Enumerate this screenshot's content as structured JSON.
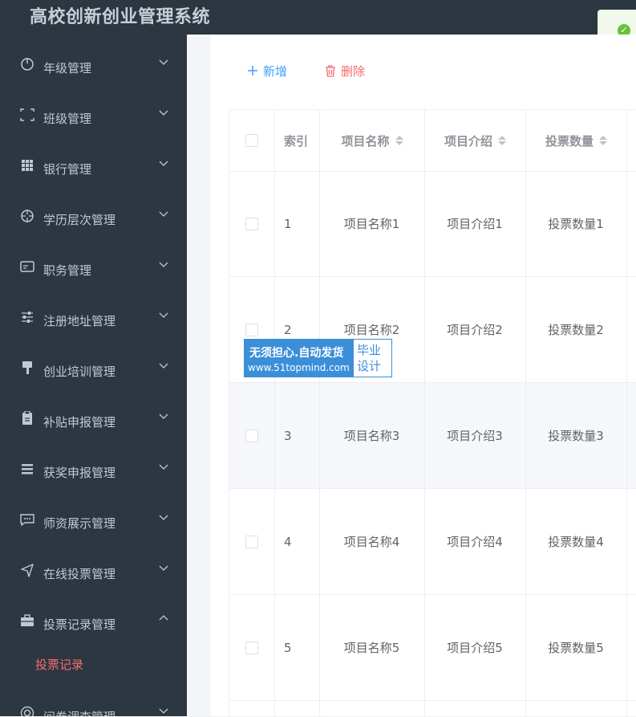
{
  "app": {
    "title": "高校创新创业管理系统"
  },
  "toast": {
    "icon": "check-circle-icon",
    "color": "#67c23a"
  },
  "sidebar": {
    "items": [
      {
        "label": "年级管理",
        "icon": "power-icon"
      },
      {
        "label": "班级管理",
        "icon": "frame-icon"
      },
      {
        "label": "银行管理",
        "icon": "grid-icon"
      },
      {
        "label": "学历层次管理",
        "icon": "crosshair-icon"
      },
      {
        "label": "职务管理",
        "icon": "card-icon"
      },
      {
        "label": "注册地址管理",
        "icon": "sliders-icon"
      },
      {
        "label": "创业培训管理",
        "icon": "brush-icon"
      },
      {
        "label": "补贴申报管理",
        "icon": "clipboard-icon"
      },
      {
        "label": "获奖申报管理",
        "icon": "list-icon"
      },
      {
        "label": "师资展示管理",
        "icon": "chat-icon"
      },
      {
        "label": "在线投票管理",
        "icon": "send-icon"
      },
      {
        "label": "投票记录管理",
        "icon": "briefcase-icon",
        "expanded": true
      },
      {
        "label": "问卷调查管理",
        "icon": "target-icon"
      }
    ],
    "submenu": [
      {
        "label": "投票记录",
        "active": true
      }
    ],
    "colors": {
      "background": "#2c3741",
      "text": "#c1c9d2",
      "active": "#f56c6c"
    }
  },
  "toolbar": {
    "add_label": "新增",
    "delete_label": "删除"
  },
  "table": {
    "columns": [
      "",
      "索引",
      "项目名称",
      "项目介绍",
      "投票数量"
    ],
    "rows": [
      {
        "index": "1",
        "name": "项目名称1",
        "intro": "项目介绍1",
        "votes": "投票数量1"
      },
      {
        "index": "2",
        "name": "项目名称2",
        "intro": "项目介绍2",
        "votes": "投票数量2"
      },
      {
        "index": "3",
        "name": "项目名称3",
        "intro": "项目介绍3",
        "votes": "投票数量3"
      },
      {
        "index": "4",
        "name": "项目名称4",
        "intro": "项目介绍4",
        "votes": "投票数量4"
      },
      {
        "index": "5",
        "name": "项目名称5",
        "intro": "项目介绍5",
        "votes": "投票数量5"
      }
    ]
  },
  "watermark": {
    "line1": "无须担心.自动发货",
    "line2": "www.51topmind.com",
    "right_top": "毕业",
    "right_bottom": "设计"
  }
}
